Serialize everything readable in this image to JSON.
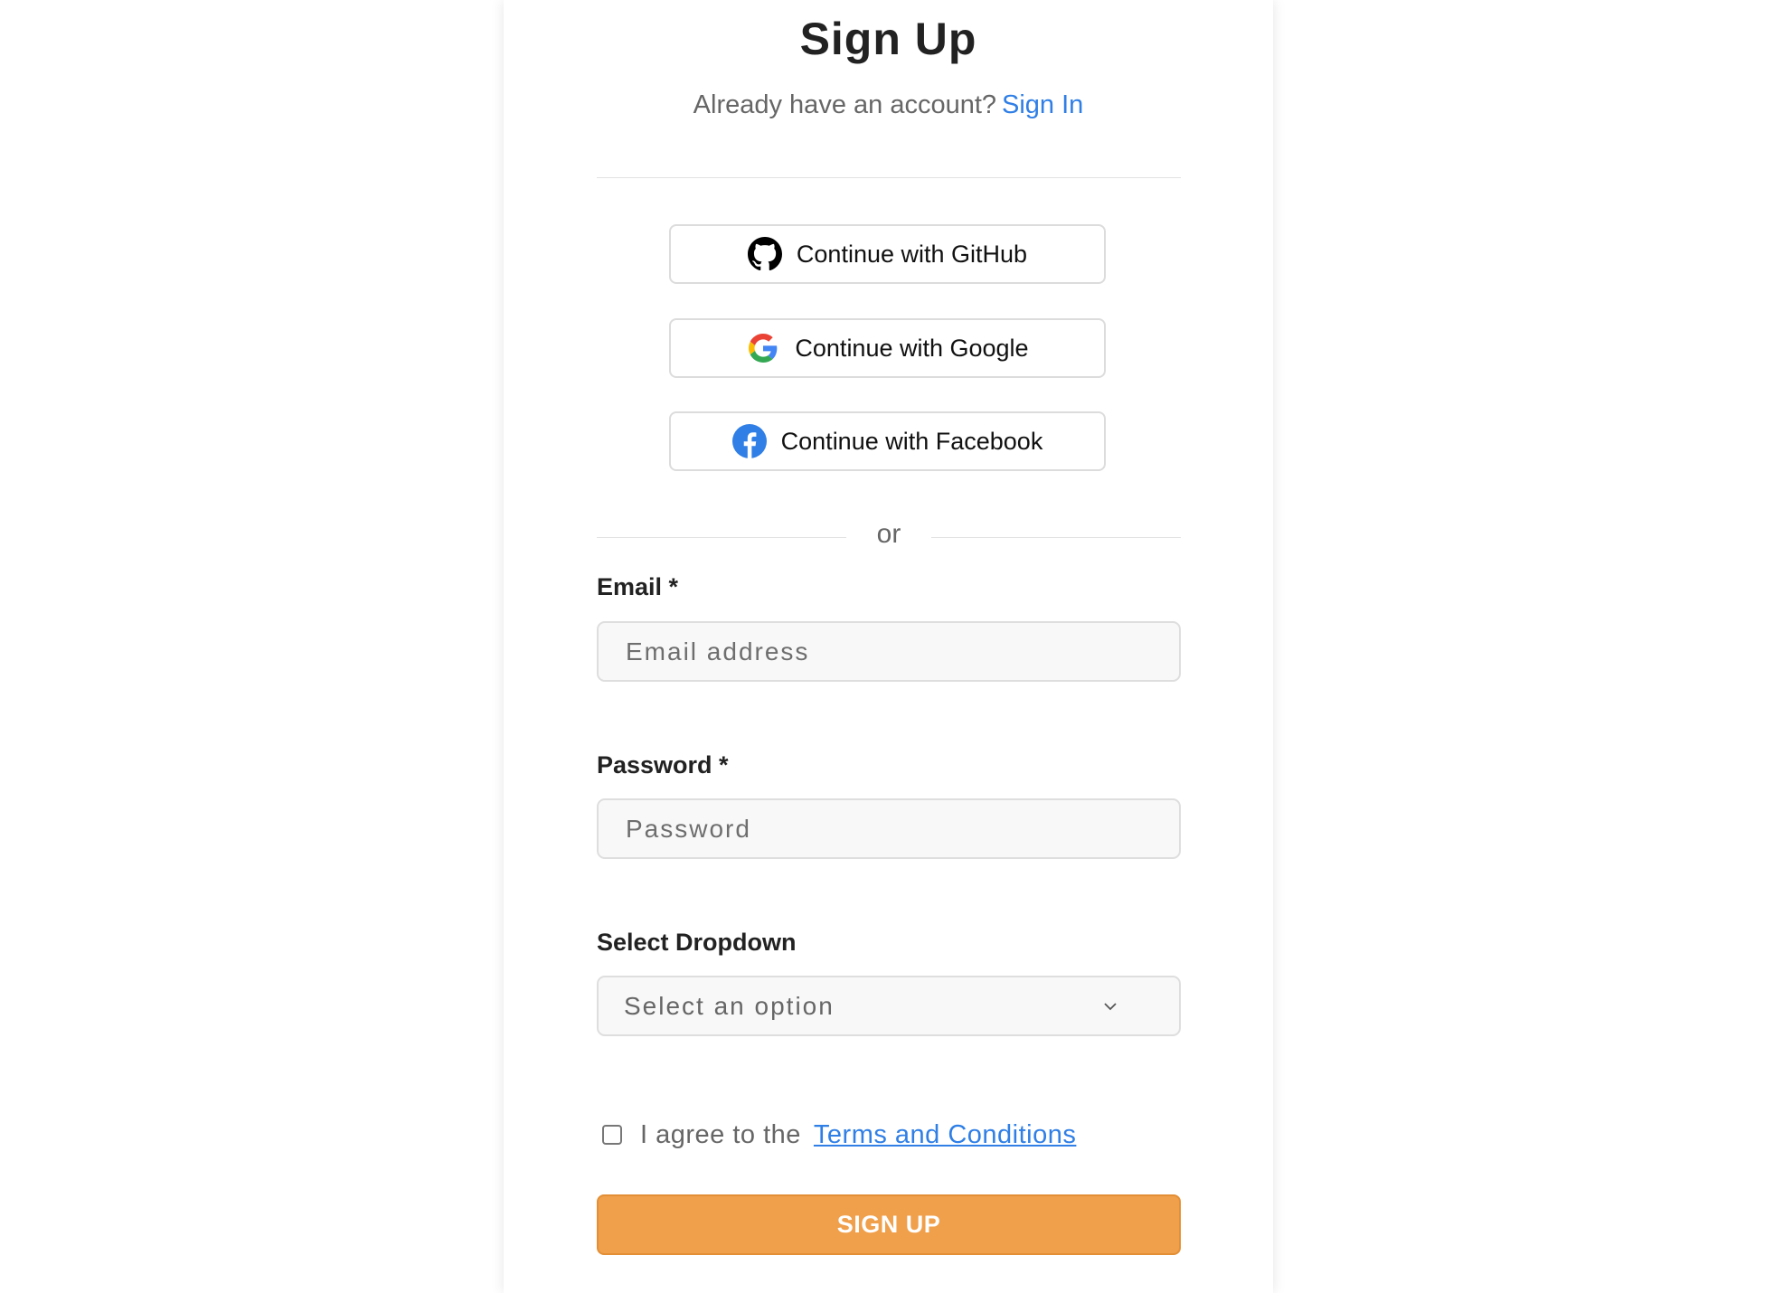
{
  "header": {
    "title": "Sign Up",
    "subtitle": "Already have an account?",
    "signin_link": "Sign In"
  },
  "social": [
    {
      "label": "Continue with GitHub",
      "icon": "github-icon"
    },
    {
      "label": "Continue with Google",
      "icon": "google-icon"
    },
    {
      "label": "Continue with Facebook",
      "icon": "facebook-icon"
    }
  ],
  "divider_text": "or",
  "form": {
    "email": {
      "label": "Email *",
      "placeholder": "Email address",
      "value": ""
    },
    "password": {
      "label": "Password *",
      "placeholder": "Password",
      "value": ""
    },
    "select": {
      "label": "Select Dropdown",
      "selected": "Select an option",
      "icon": "chevron-down-icon"
    },
    "agree": {
      "text": "I agree to the",
      "link": "Terms and Conditions",
      "checked": false
    },
    "submit_label": "SIGN UP"
  },
  "colors": {
    "accent_link": "#2f7fe6",
    "submit": "#f09f4a",
    "title": "#222222"
  }
}
